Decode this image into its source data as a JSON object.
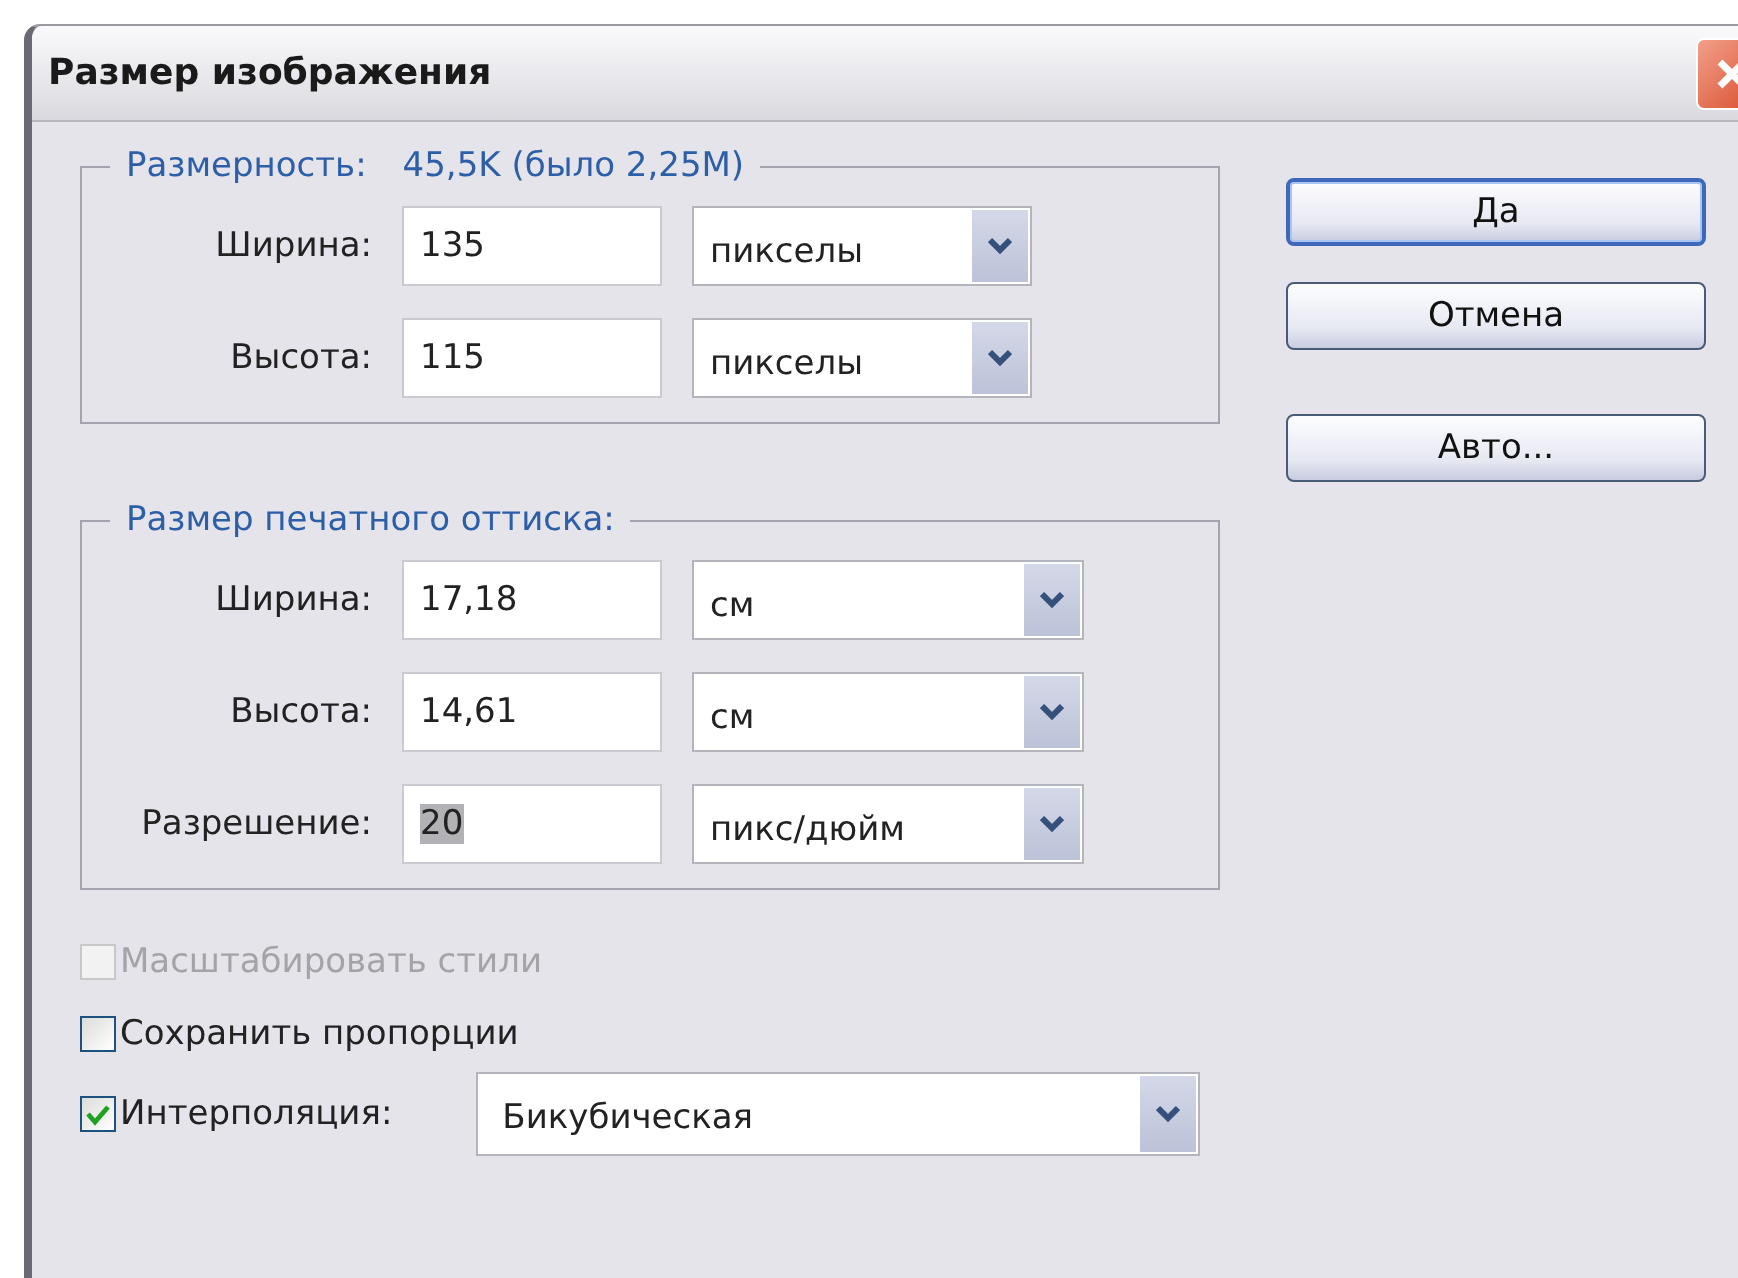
{
  "window": {
    "title": "Размер изображения"
  },
  "pixel_dimensions": {
    "legend": "Размерность:",
    "size": "45,5K (было 2,25M)",
    "rows": [
      {
        "label": "Ширина:",
        "value": "135",
        "selected": false,
        "unit": "пикселы"
      },
      {
        "label": "Высота:",
        "value": "115",
        "selected": false,
        "unit": "пикселы"
      }
    ]
  },
  "print_size": {
    "legend": "Размер печатного оттиска:",
    "rows": [
      {
        "label": "Ширина:",
        "value": "17,18",
        "selected": false,
        "unit": "см"
      },
      {
        "label": "Высота:",
        "value": "14,61",
        "selected": false,
        "unit": "см"
      },
      {
        "label": "Разрешение:",
        "value": "20",
        "selected": true,
        "unit": "пикс/дюйм"
      }
    ]
  },
  "options": [
    {
      "label": "Масштабировать стили",
      "checked": false,
      "disabled": true
    },
    {
      "label": "Сохранить пропорции",
      "checked": false,
      "disabled": false
    }
  ],
  "interpolation": {
    "label": "Интерполяция:",
    "checked": true,
    "value": "Бикубическая"
  },
  "buttons": [
    {
      "label": "Да",
      "default": true
    },
    {
      "label": "Отмена",
      "default": false
    },
    {
      "label": "Авто...",
      "default": false
    }
  ]
}
